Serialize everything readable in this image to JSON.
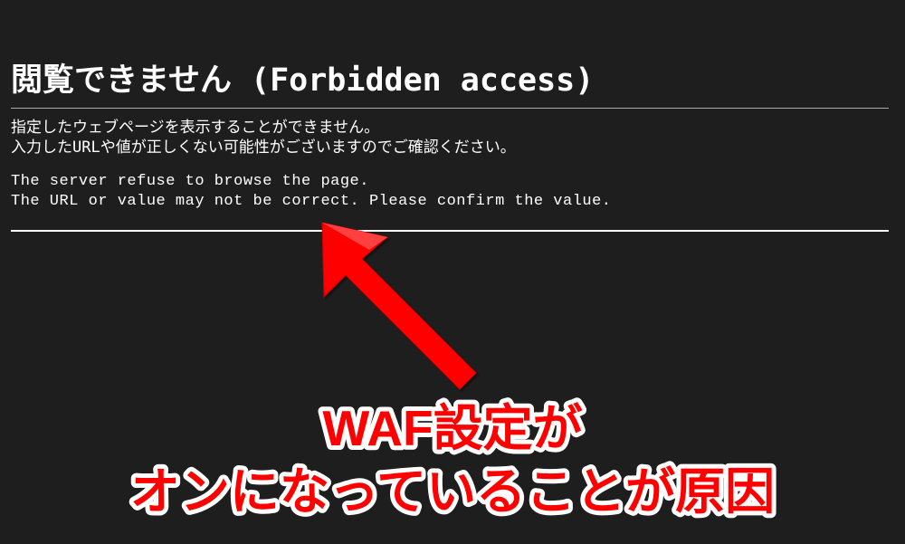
{
  "page": {
    "heading": "閲覧できません (Forbidden access)",
    "jp_line_1": "指定したウェブページを表示することができません。",
    "jp_line_2": "入力したURLや値が正しくない可能性がございますのでご確認ください。",
    "en_line_1": "The server refuse to browse the page.",
    "en_line_2": "The URL or value may not be correct. Please confirm the value."
  },
  "annotation": {
    "line_1": "WAF設定が",
    "line_2": "オンになっていることが原因"
  },
  "colors": {
    "background": "#1e1e1e",
    "text": "#ffffff",
    "accent_red": "#ff0000",
    "stroke_white": "#ffffff"
  }
}
